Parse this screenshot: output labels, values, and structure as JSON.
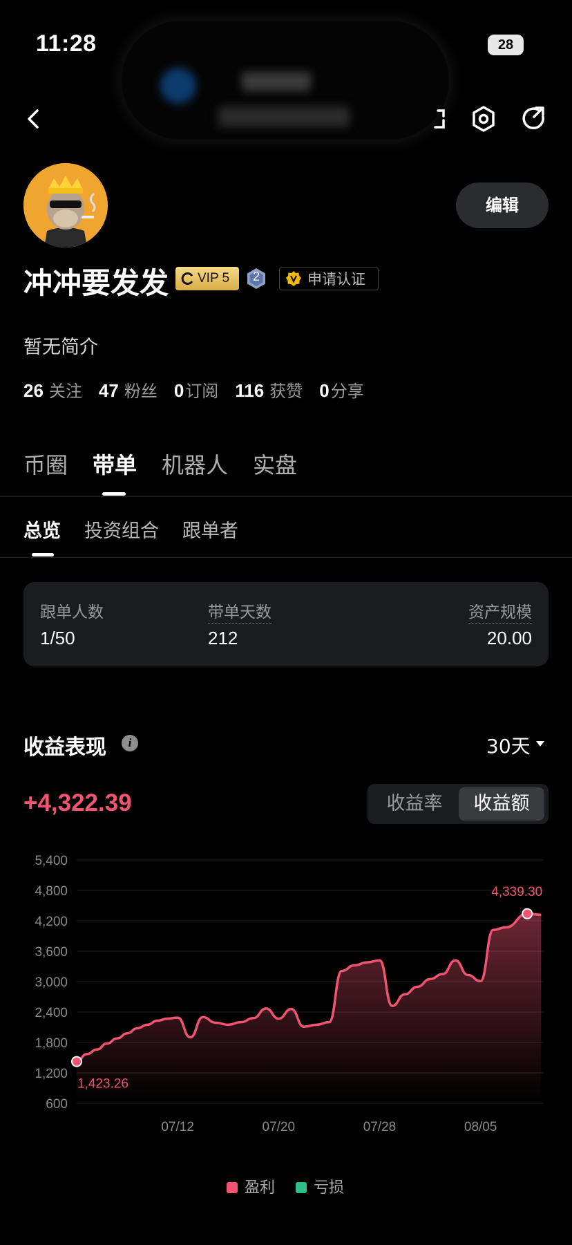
{
  "status_bar": {
    "time": "11:28",
    "battery": "28"
  },
  "profile": {
    "username": "冲冲要发发",
    "vip_label": "VIP 5",
    "level": "2",
    "certify_label": "申请认证",
    "edit_label": "编辑",
    "bio": "暂无简介",
    "stats": [
      {
        "value": "26",
        "label": "关注"
      },
      {
        "value": "47",
        "label": "粉丝"
      },
      {
        "value": "0",
        "label": "订阅"
      },
      {
        "value": "116",
        "label": "获赞"
      },
      {
        "value": "0",
        "label": "分享"
      }
    ]
  },
  "main_tabs": [
    "币圈",
    "带单",
    "机器人",
    "实盘"
  ],
  "main_tab_active": "带单",
  "sub_tabs": [
    "总览",
    "投资组合",
    "跟单者"
  ],
  "sub_tab_active": "总览",
  "summary": {
    "followers_label": "跟单人数",
    "followers_value": "1/50",
    "days_label": "带单天数",
    "days_value": "212",
    "aum_label": "资产规模",
    "aum_value": "20.00"
  },
  "performance": {
    "title": "收益表现",
    "period": "30天",
    "total": "+4,322.39",
    "toggle": [
      "收益率",
      "收益额"
    ],
    "toggle_active": "收益额",
    "legend": [
      {
        "label": "盈利",
        "color": "#f05470"
      },
      {
        "label": "亏损",
        "color": "#2fbf8a"
      }
    ]
  },
  "colors": {
    "accent_red": "#f05470",
    "accent_green": "#2fbf8a",
    "card_bg": "#1b1c1e"
  },
  "chart_data": {
    "type": "area",
    "y_ticks": [
      "5,400",
      "4,800",
      "4,200",
      "3,600",
      "3,000",
      "2,400",
      "1,800",
      "1,200",
      "600"
    ],
    "ylim": [
      600,
      5400
    ],
    "x_ticks": [
      {
        "label": "07/12",
        "day": 8
      },
      {
        "label": "07/20",
        "day": 16
      },
      {
        "label": "07/28",
        "day": 24
      },
      {
        "label": "08/05",
        "day": 32
      }
    ],
    "start_label": "1,423.26",
    "end_label": "4,339.30",
    "series": [
      {
        "values": [
          1423,
          1570,
          1660,
          1780,
          1880,
          1980,
          2080,
          2150,
          2230,
          2270,
          2290,
          1900,
          2300,
          2190,
          2150,
          2200,
          2280,
          2470,
          2270,
          2460,
          2110,
          2150,
          2200,
          3210,
          3320,
          3380,
          3420,
          2520,
          2750,
          2900,
          3050,
          3150,
          3420,
          3130,
          3010,
          4020,
          4070,
          4339,
          4320
        ],
        "days": [
          0,
          0.8,
          1.6,
          2.4,
          3.2,
          4,
          4.8,
          5.6,
          6.4,
          7.2,
          8,
          9,
          10,
          11,
          12,
          13,
          14,
          15,
          16,
          17,
          18,
          19,
          20,
          21,
          22,
          23,
          24,
          25,
          26,
          27,
          28,
          29,
          30,
          31,
          32,
          33,
          34,
          35.7,
          36.8
        ]
      }
    ]
  }
}
